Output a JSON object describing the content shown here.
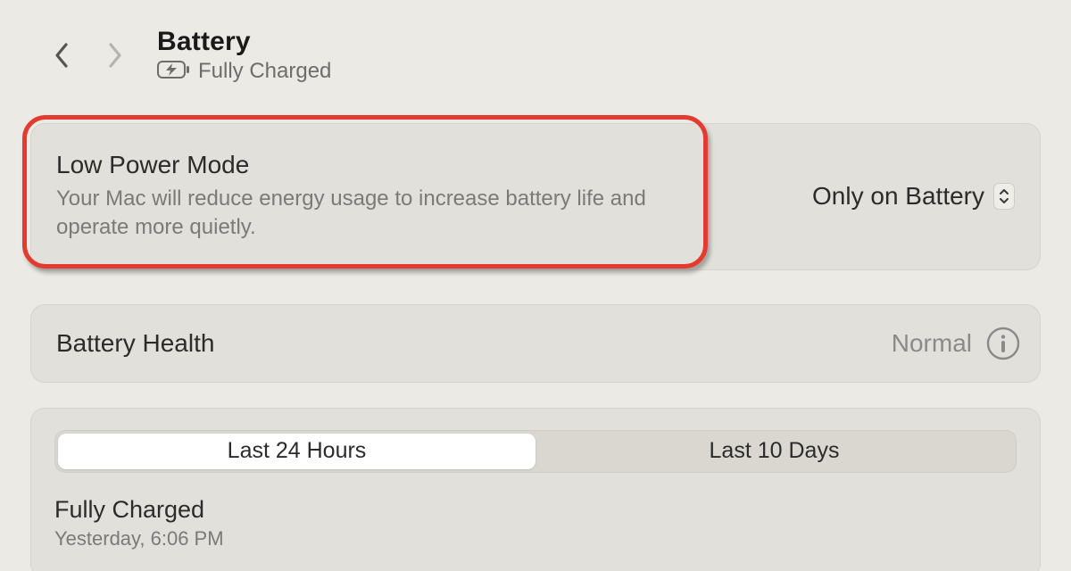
{
  "header": {
    "title": "Battery",
    "subtitle": "Fully Charged"
  },
  "lowPower": {
    "title": "Low Power Mode",
    "description": "Your Mac will reduce energy usage to increase battery life and operate more quietly.",
    "selected_value": "Only on Battery"
  },
  "health": {
    "title": "Battery Health",
    "status": "Normal"
  },
  "usage": {
    "tabs": [
      {
        "label": "Last 24 Hours",
        "selected": true
      },
      {
        "label": "Last 10 Days",
        "selected": false
      }
    ],
    "status_title": "Fully Charged",
    "status_time": "Yesterday, 6:06 PM"
  }
}
